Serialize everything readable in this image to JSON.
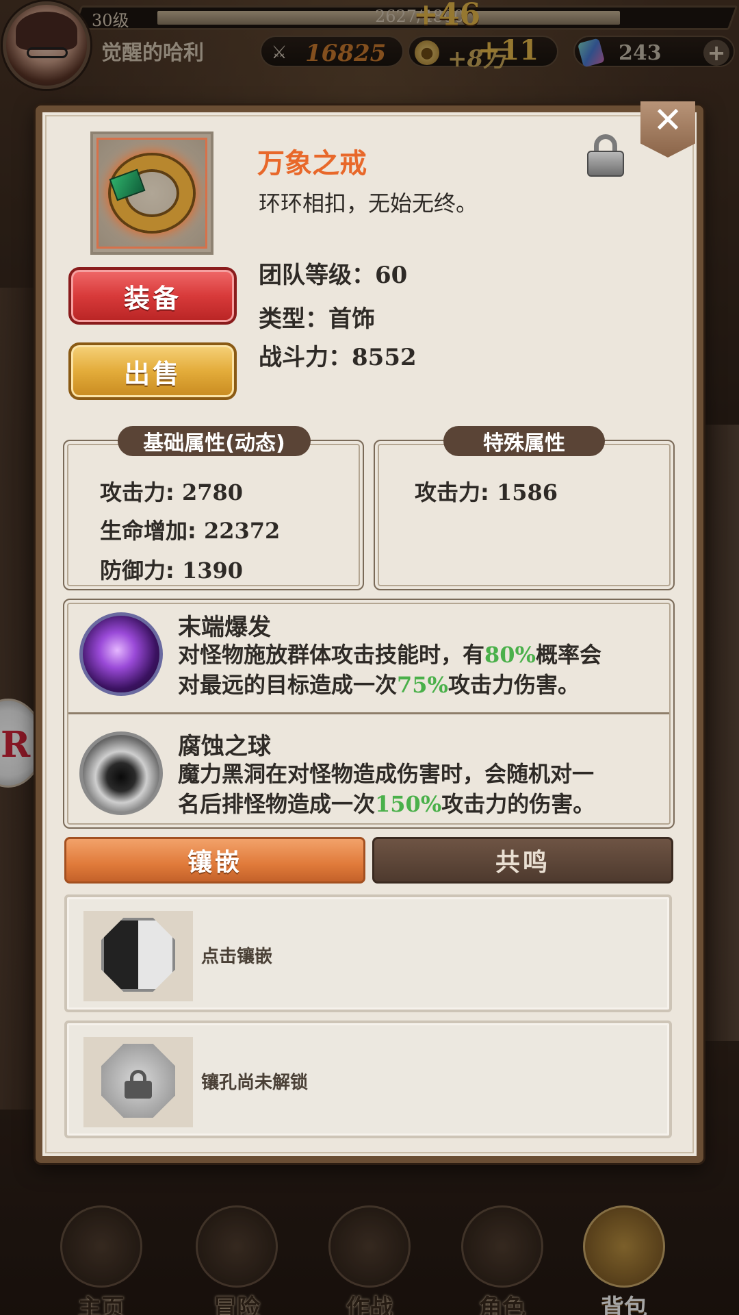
{
  "topbar": {
    "level": "30级",
    "exp": "2627/4800",
    "exp_gain": "+46",
    "player_name": "觉醒的哈利",
    "power": "16825",
    "coins": "+8万",
    "coin_gain": "+11",
    "gems": "243",
    "plus_label": "+"
  },
  "item": {
    "name": "万象之戒",
    "description": "环环相扣，无始无终。",
    "team_level_label": "团队等级：",
    "team_level": "60",
    "type_label": "类型：",
    "type": "首饰",
    "power_label": "战斗力：",
    "power": "8552",
    "rarity_color": "#e8682a"
  },
  "actions": {
    "equip": "装备",
    "sell": "出售",
    "close": "✕"
  },
  "base_attributes": {
    "title": "基础属性(动态)",
    "items": [
      {
        "label": "攻击力:",
        "value": "2780"
      },
      {
        "label": "生命增加:",
        "value": "22372"
      },
      {
        "label": "防御力:",
        "value": "1390"
      }
    ]
  },
  "special_attributes": {
    "title": "特殊属性",
    "items": [
      {
        "label": "攻击力:",
        "value": "1586"
      }
    ]
  },
  "skills": [
    {
      "name": "末端爆发",
      "line1_a": "对怪物施放群体攻击技能时，有",
      "line1_hl": "80%",
      "line1_b": "概率会",
      "line2_a": "对最远的目标造成一次",
      "line2_hl": "75%",
      "line2_b": "攻击力伤害。",
      "icon": "purple-skull-icon"
    },
    {
      "name": "腐蚀之球",
      "line1_a": "魔力黑洞在对怪物造成伤害时，会随机对一",
      "line2_a": "名后排怪物造成一次",
      "line2_hl": "150%",
      "line2_b": "攻击力的伤害。",
      "icon": "black-hole-icon"
    }
  ],
  "tabs": {
    "inlay": "镶嵌",
    "resonance": "共鸣"
  },
  "slots": [
    {
      "label": "点击镶嵌",
      "state": "empty"
    },
    {
      "label": "镶孔尚未解锁",
      "state": "locked"
    }
  ],
  "nav": [
    {
      "label": "主页"
    },
    {
      "label": "冒险"
    },
    {
      "label": "作战"
    },
    {
      "label": "角色"
    },
    {
      "label": "背包"
    }
  ],
  "side_badge": "R"
}
